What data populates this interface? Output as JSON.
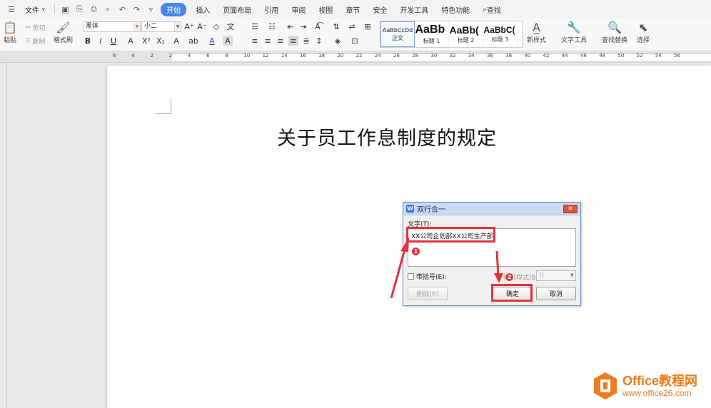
{
  "menubar": {
    "file": "文件",
    "tabs": [
      "开始",
      "插入",
      "页面布局",
      "引用",
      "审阅",
      "视图",
      "章节",
      "安全",
      "开发工具",
      "特色功能"
    ],
    "active_tab": "开始",
    "search": "查找"
  },
  "ribbon": {
    "paste": "粘贴",
    "cut": "剪切",
    "copy": "复制",
    "format_painter": "格式刷",
    "font_name": "黑体",
    "font_size": "小二",
    "styles": [
      {
        "preview": "AaBbCcDd",
        "label": "正文"
      },
      {
        "preview": "AaBb",
        "label": "标题 1"
      },
      {
        "preview": "AaBb(",
        "label": "标题 2"
      },
      {
        "preview": "AaBbC(",
        "label": "标题 3"
      }
    ],
    "new_style": "新样式",
    "text_tools": "文字工具",
    "find_replace": "查找替换",
    "select": "选择"
  },
  "ruler": [
    "6",
    "4",
    "2",
    "2",
    "4",
    "6",
    "8",
    "10",
    "12",
    "14",
    "16",
    "18",
    "20",
    "22",
    "24",
    "26",
    "28",
    "30",
    "32",
    "34",
    "36",
    "38",
    "40",
    "42",
    "44",
    "46",
    "48",
    "50",
    "52",
    "54",
    "56"
  ],
  "document": {
    "title": "关于员工作息制度的规定"
  },
  "dialog": {
    "title": "双行合一",
    "text_label": "文字(T):",
    "text_value": "XX公司企划部XX公司生产部",
    "bracket_label": "带括号(E):",
    "style_label": "括号样式(B):",
    "style_value": "()",
    "delete_button": "删除(R)",
    "ok_button": "确定",
    "cancel_button": "取消"
  },
  "annotations": {
    "step1": "1",
    "step2": "2",
    "color": "#e8313a"
  },
  "watermark": {
    "brand": "Office教程网",
    "url": "www.office26.com"
  }
}
